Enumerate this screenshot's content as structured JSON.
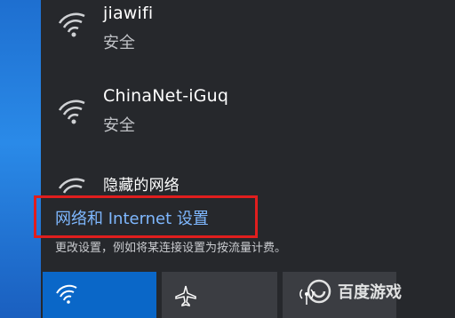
{
  "networks": [
    {
      "ssid": "jiawifi",
      "security": "安全"
    },
    {
      "ssid": "ChinaNet-iGuq",
      "security": "安全"
    },
    {
      "ssid": "隐藏的网络"
    }
  ],
  "settings_link": {
    "label": "网络和 Internet 设置"
  },
  "settings_hint": {
    "text": "更改设置，例如将某连接设置为按流量计费。"
  },
  "quick_actions": [
    {
      "name": "wifi",
      "icon": "wifi-icon",
      "active": true
    },
    {
      "name": "airplane",
      "icon": "airplane-icon",
      "active": false
    },
    {
      "name": "hotspot",
      "icon": "hotspot-icon",
      "active": false
    }
  ],
  "watermark": {
    "text": "百度游戏"
  },
  "colors": {
    "accent": "#0a67c8",
    "highlight": "#e01e1e",
    "link": "#7fb8ff"
  }
}
